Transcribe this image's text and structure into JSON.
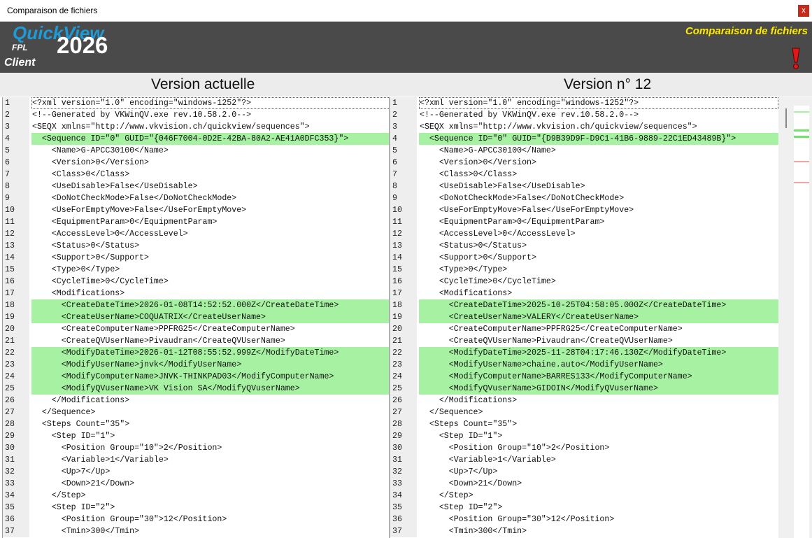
{
  "window": {
    "title": "Comparaison de fichiers",
    "close_label": "x"
  },
  "banner": {
    "brand": "QuickView",
    "fpl": "FPL",
    "year": "2026",
    "client": "Client",
    "title": "Comparaison de fichiers",
    "accent_color": "#1e9bd7",
    "title_color": "#ffea00",
    "alert_icon": "exclamation-icon"
  },
  "headers": {
    "left": "Version actuelle",
    "right": "Version n° 12"
  },
  "diff_color": "#a6f2a2",
  "left_lines": [
    {
      "n": "1",
      "text": "<?xml version=\"1.0\" encoding=\"windows-1252\"?>",
      "diff": false
    },
    {
      "n": "2",
      "text": "<!--Generated by VKWinQV.exe rev.10.58.2.0-->",
      "diff": false
    },
    {
      "n": "3",
      "text": "<SEQX xmlns=\"http://www.vkvision.ch/quickview/sequences\">",
      "diff": false
    },
    {
      "n": "4",
      "text": "  <Sequence ID=\"0\" GUID=\"{046F7004-0D2E-42BA-80A2-AE41A0DFC353}\">",
      "diff": true
    },
    {
      "n": "5",
      "text": "    <Name>G-APCC30100</Name>",
      "diff": false
    },
    {
      "n": "6",
      "text": "    <Version>0</Version>",
      "diff": false
    },
    {
      "n": "7",
      "text": "    <Class>0</Class>",
      "diff": false
    },
    {
      "n": "8",
      "text": "    <UseDisable>False</UseDisable>",
      "diff": false
    },
    {
      "n": "9",
      "text": "    <DoNotCheckMode>False</DoNotCheckMode>",
      "diff": false
    },
    {
      "n": "10",
      "text": "    <UseForEmptyMove>False</UseForEmptyMove>",
      "diff": false
    },
    {
      "n": "11",
      "text": "    <EquipmentParam>0</EquipmentParam>",
      "diff": false
    },
    {
      "n": "12",
      "text": "    <AccessLevel>0</AccessLevel>",
      "diff": false
    },
    {
      "n": "13",
      "text": "    <Status>0</Status>",
      "diff": false
    },
    {
      "n": "14",
      "text": "    <Support>0</Support>",
      "diff": false
    },
    {
      "n": "15",
      "text": "    <Type>0</Type>",
      "diff": false
    },
    {
      "n": "16",
      "text": "    <CycleTime>0</CycleTime>",
      "diff": false
    },
    {
      "n": "17",
      "text": "    <Modifications>",
      "diff": false
    },
    {
      "n": "18",
      "text": "      <CreateDateTime>2026-01-08T14:52:52.000Z</CreateDateTime>",
      "diff": true
    },
    {
      "n": "19",
      "text": "      <CreateUserName>COQUATRIX</CreateUserName>",
      "diff": true
    },
    {
      "n": "20",
      "text": "      <CreateComputerName>PPFRG25</CreateComputerName>",
      "diff": false
    },
    {
      "n": "21",
      "text": "      <CreateQVUserName>Pivaudran</CreateQVUserName>",
      "diff": false
    },
    {
      "n": "22",
      "text": "      <ModifyDateTime>2026-01-12T08:55:52.999Z</ModifyDateTime>",
      "diff": true
    },
    {
      "n": "23",
      "text": "      <ModifyUserName>jnvk</ModifyUserName>",
      "diff": true
    },
    {
      "n": "24",
      "text": "      <ModifyComputerName>JNVK-THINKPAD03</ModifyComputerName>",
      "diff": true
    },
    {
      "n": "25",
      "text": "      <ModifyQVuserName>VK Vision SA</ModifyQVuserName>",
      "diff": true
    },
    {
      "n": "26",
      "text": "    </Modifications>",
      "diff": false
    },
    {
      "n": "27",
      "text": "  </Sequence>",
      "diff": false
    },
    {
      "n": "28",
      "text": "  <Steps Count=\"35\">",
      "diff": false
    },
    {
      "n": "29",
      "text": "    <Step ID=\"1\">",
      "diff": false
    },
    {
      "n": "30",
      "text": "      <Position Group=\"10\">2</Position>",
      "diff": false
    },
    {
      "n": "31",
      "text": "      <Variable>1</Variable>",
      "diff": false
    },
    {
      "n": "32",
      "text": "      <Up>7</Up>",
      "diff": false
    },
    {
      "n": "33",
      "text": "      <Down>21</Down>",
      "diff": false
    },
    {
      "n": "34",
      "text": "    </Step>",
      "diff": false
    },
    {
      "n": "35",
      "text": "    <Step ID=\"2\">",
      "diff": false
    },
    {
      "n": "36",
      "text": "      <Position Group=\"30\">12</Position>",
      "diff": false
    },
    {
      "n": "37",
      "text": "      <Tmin>300</Tmin>",
      "diff": false
    }
  ],
  "right_lines": [
    {
      "n": "1",
      "text": "<?xml version=\"1.0\" encoding=\"windows-1252\"?>",
      "diff": false
    },
    {
      "n": "2",
      "text": "<!--Generated by VKWinQV.exe rev.10.58.2.0-->",
      "diff": false
    },
    {
      "n": "3",
      "text": "<SEQX xmlns=\"http://www.vkvision.ch/quickview/sequences\">",
      "diff": false
    },
    {
      "n": "4",
      "text": "  <Sequence ID=\"0\" GUID=\"{D9B39D9F-D9C1-41B6-9889-22C1ED43489B}\">",
      "diff": true
    },
    {
      "n": "5",
      "text": "    <Name>G-APCC30100</Name>",
      "diff": false
    },
    {
      "n": "6",
      "text": "    <Version>0</Version>",
      "diff": false
    },
    {
      "n": "7",
      "text": "    <Class>0</Class>",
      "diff": false
    },
    {
      "n": "8",
      "text": "    <UseDisable>False</UseDisable>",
      "diff": false
    },
    {
      "n": "9",
      "text": "    <DoNotCheckMode>False</DoNotCheckMode>",
      "diff": false
    },
    {
      "n": "10",
      "text": "    <UseForEmptyMove>False</UseForEmptyMove>",
      "diff": false
    },
    {
      "n": "11",
      "text": "    <EquipmentParam>0</EquipmentParam>",
      "diff": false
    },
    {
      "n": "12",
      "text": "    <AccessLevel>0</AccessLevel>",
      "diff": false
    },
    {
      "n": "13",
      "text": "    <Status>0</Status>",
      "diff": false
    },
    {
      "n": "14",
      "text": "    <Support>0</Support>",
      "diff": false
    },
    {
      "n": "15",
      "text": "    <Type>0</Type>",
      "diff": false
    },
    {
      "n": "16",
      "text": "    <CycleTime>0</CycleTime>",
      "diff": false
    },
    {
      "n": "17",
      "text": "    <Modifications>",
      "diff": false
    },
    {
      "n": "18",
      "text": "      <CreateDateTime>2025-10-25T04:58:05.000Z</CreateDateTime>",
      "diff": true
    },
    {
      "n": "19",
      "text": "      <CreateUserName>VALERY</CreateUserName>",
      "diff": true
    },
    {
      "n": "20",
      "text": "      <CreateComputerName>PPFRG25</CreateComputerName>",
      "diff": false
    },
    {
      "n": "21",
      "text": "      <CreateQVUserName>Pivaudran</CreateQVUserName>",
      "diff": false
    },
    {
      "n": "22",
      "text": "      <ModifyDateTime>2025-11-28T04:17:46.130Z</ModifyDateTime>",
      "diff": true
    },
    {
      "n": "23",
      "text": "      <ModifyUserName>chaine.auto</ModifyUserName>",
      "diff": true
    },
    {
      "n": "24",
      "text": "      <ModifyComputerName>BARRES133</ModifyComputerName>",
      "diff": true
    },
    {
      "n": "25",
      "text": "      <ModifyQVuserName>GIDOIN</ModifyQVuserName>",
      "diff": true
    },
    {
      "n": "26",
      "text": "    </Modifications>",
      "diff": false
    },
    {
      "n": "27",
      "text": "  </Sequence>",
      "diff": false
    },
    {
      "n": "28",
      "text": "  <Steps Count=\"35\">",
      "diff": false
    },
    {
      "n": "29",
      "text": "    <Step ID=\"1\">",
      "diff": false
    },
    {
      "n": "30",
      "text": "      <Position Group=\"10\">2</Position>",
      "diff": false
    },
    {
      "n": "31",
      "text": "      <Variable>1</Variable>",
      "diff": false
    },
    {
      "n": "32",
      "text": "      <Up>7</Up>",
      "diff": false
    },
    {
      "n": "33",
      "text": "      <Down>21</Down>",
      "diff": false
    },
    {
      "n": "34",
      "text": "    </Step>",
      "diff": false
    },
    {
      "n": "35",
      "text": "    <Step ID=\"2\">",
      "diff": false
    },
    {
      "n": "36",
      "text": "      <Position Group=\"30\">12</Position>",
      "diff": false
    },
    {
      "n": "37",
      "text": "      <Tmin>300</Tmin>",
      "diff": false
    }
  ],
  "overview": {
    "marks": [
      {
        "color": "#a6f2a2"
      },
      {
        "color": "#6fe36a"
      },
      {
        "color": "#6fe36a"
      },
      {
        "color": "#f4a3a3"
      },
      {
        "color": "#f4a3a3"
      }
    ]
  }
}
